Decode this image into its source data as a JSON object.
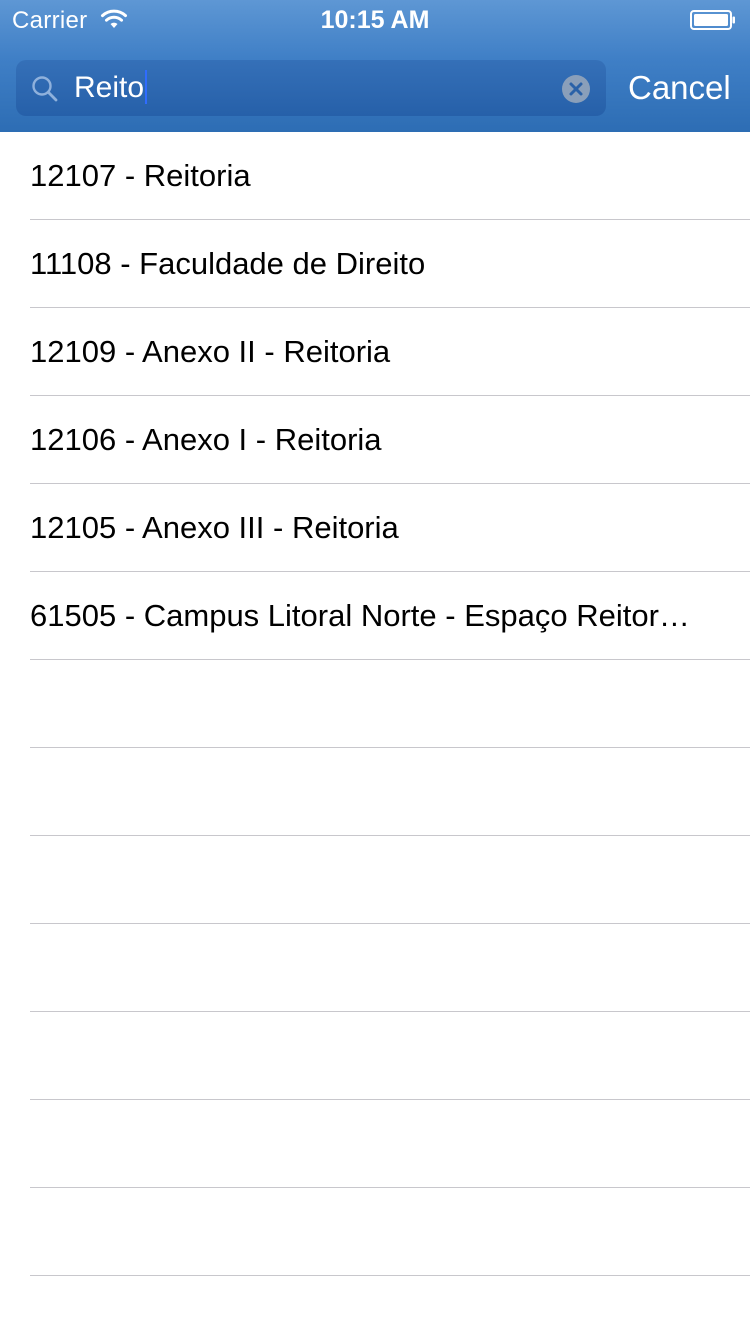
{
  "status_bar": {
    "carrier": "Carrier",
    "time": "10:15 AM",
    "wifi_icon": "wifi-icon",
    "battery_icon": "battery-icon"
  },
  "search": {
    "value": "Reito",
    "search_icon": "search-icon",
    "clear_icon": "clear-icon",
    "cancel_label": "Cancel"
  },
  "colors": {
    "header_top": "#5e97d4",
    "header_bottom": "#2d6db4",
    "search_field": "#2a61a8",
    "caret": "#2f6cff",
    "separator": "#c8c7cc"
  },
  "results": [
    {
      "label": "12107 - Reitoria"
    },
    {
      "label": "11108 - Faculdade de Direito"
    },
    {
      "label": "12109 - Anexo II - Reitoria"
    },
    {
      "label": "12106 - Anexo I - Reitoria"
    },
    {
      "label": "12105 - Anexo III - Reitoria"
    },
    {
      "label": "61505 - Campus Litoral Norte - Espaço Reitor…"
    },
    {
      "label": ""
    },
    {
      "label": ""
    },
    {
      "label": ""
    },
    {
      "label": ""
    },
    {
      "label": ""
    },
    {
      "label": ""
    },
    {
      "label": ""
    }
  ]
}
